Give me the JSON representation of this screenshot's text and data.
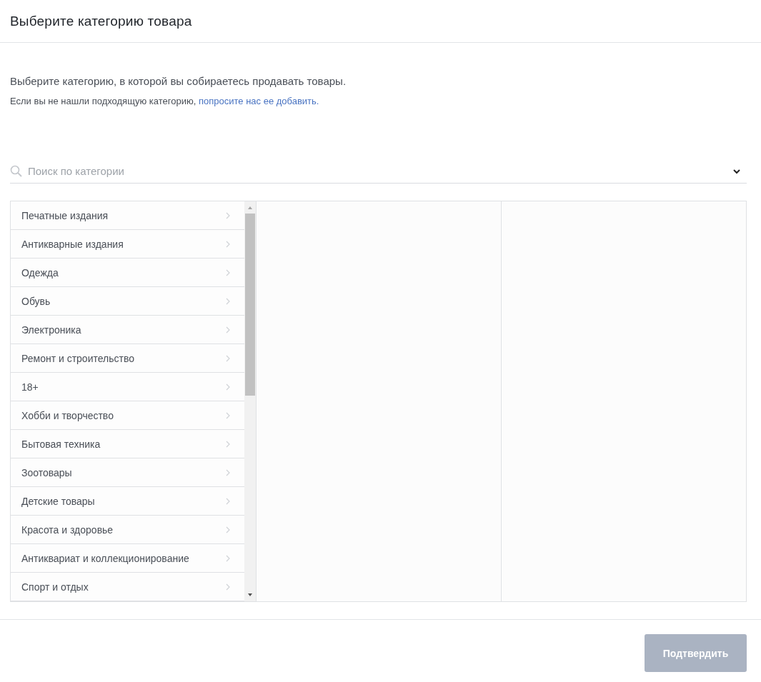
{
  "header": {
    "title": "Выберите категорию товара"
  },
  "intro": {
    "text": "Выберите категорию, в которой вы собираетесь продавать товары.",
    "hint": "Если вы не нашли подходящую категорию,",
    "link": "попросите нас ее добавить."
  },
  "search": {
    "placeholder": "Поиск по категории"
  },
  "categories": [
    {
      "label": "Печатные издания",
      "selected": false
    },
    {
      "label": "Антикварные издания",
      "selected": false
    },
    {
      "label": "Одежда",
      "selected": false
    },
    {
      "label": "Обувь",
      "selected": false
    },
    {
      "label": "Электроника",
      "selected": false
    },
    {
      "label": "Ремонт и строительство",
      "selected": false
    },
    {
      "label": "18+",
      "selected": false
    },
    {
      "label": "Хобби и творчество",
      "selected": false
    },
    {
      "label": "Бытовая техника",
      "selected": false
    },
    {
      "label": "Зоотовары",
      "selected": false
    },
    {
      "label": "Детские товары",
      "selected": false
    },
    {
      "label": "Красота и здоровье",
      "selected": false
    },
    {
      "label": "Антиквариат и коллекционирование",
      "selected": false
    },
    {
      "label": "Спорт и отдых",
      "selected": false
    }
  ],
  "confirm_button": {
    "label": "Подтвердить",
    "disabled": true
  }
}
